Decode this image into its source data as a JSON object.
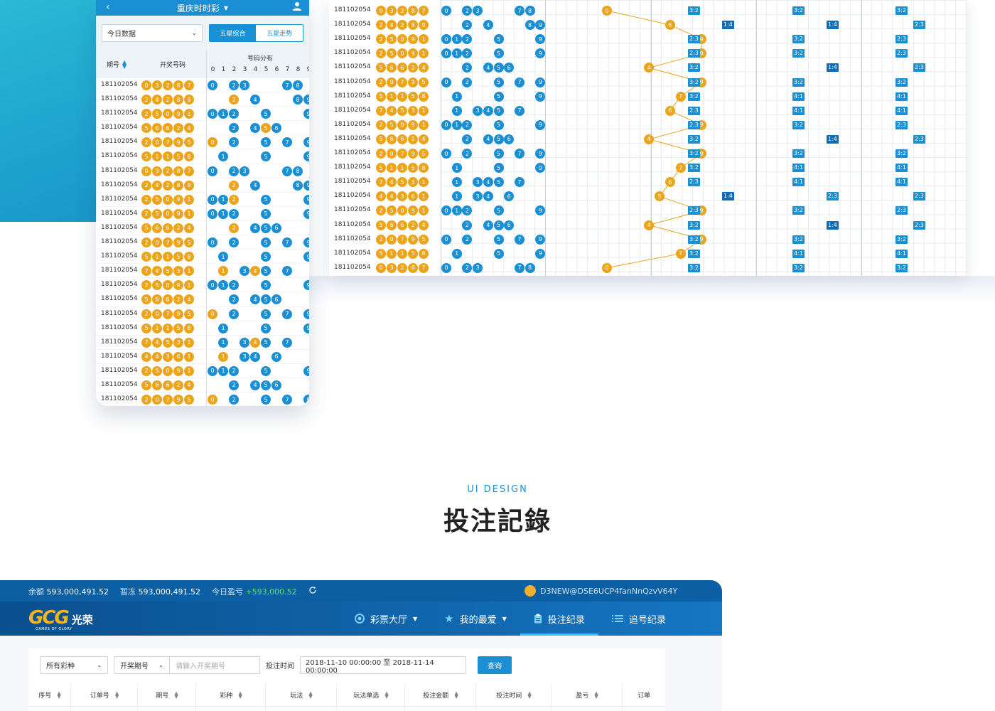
{
  "phone": {
    "title": "重庆时时彩",
    "filter_select": "今日数据",
    "seg": [
      "五星综合",
      "五星走势"
    ],
    "col_period": "期号",
    "col_numbers": "开奖号码",
    "col_distribution": "号码分布",
    "dist_digits": [
      "0",
      "1",
      "2",
      "3",
      "4",
      "5",
      "6",
      "7",
      "8",
      "9"
    ],
    "rows": [
      {
        "id": "181102054",
        "nums": [
          "0",
          "3",
          "2",
          "8",
          "7"
        ],
        "dist": [
          "0",
          "2",
          "3",
          "7",
          "8"
        ]
      },
      {
        "id": "181102054",
        "nums": [
          "2",
          "4",
          "2",
          "8",
          "9"
        ],
        "dist": [
          "2",
          "4",
          "8",
          "9"
        ]
      },
      {
        "id": "181102054",
        "nums": [
          "2",
          "5",
          "0",
          "9",
          "1"
        ],
        "dist": [
          "0",
          "1",
          "2",
          "5",
          "9"
        ]
      },
      {
        "id": "181102054",
        "nums": [
          "5",
          "6",
          "6",
          "2",
          "4"
        ],
        "dist": [
          "2",
          "4",
          "5",
          "6"
        ]
      },
      {
        "id": "181102054",
        "nums": [
          "2",
          "0",
          "7",
          "9",
          "5"
        ],
        "dist": [
          "0",
          "2",
          "5",
          "7",
          "9"
        ]
      },
      {
        "id": "181102054",
        "nums": [
          "5",
          "1",
          "1",
          "5",
          "8"
        ],
        "dist": [
          "1",
          "5",
          "9"
        ]
      },
      {
        "id": "181102054",
        "nums": [
          "0",
          "3",
          "2",
          "8",
          "7"
        ],
        "dist": [
          "0",
          "2",
          "3",
          "7",
          "8"
        ]
      },
      {
        "id": "181102054",
        "nums": [
          "2",
          "4",
          "2",
          "8",
          "9"
        ],
        "dist": [
          "2",
          "4",
          "8",
          "9"
        ]
      },
      {
        "id": "181102054",
        "nums": [
          "2",
          "5",
          "0",
          "9",
          "1"
        ],
        "dist": [
          "0",
          "1",
          "2",
          "5",
          "9"
        ]
      },
      {
        "id": "181102054",
        "nums": [
          "2",
          "5",
          "0",
          "9",
          "1"
        ],
        "dist": [
          "0",
          "1",
          "2",
          "5",
          "9"
        ]
      },
      {
        "id": "181102054",
        "nums": [
          "5",
          "6",
          "6",
          "2",
          "4"
        ],
        "dist": [
          "2",
          "4",
          "5",
          "6"
        ]
      },
      {
        "id": "181102054",
        "nums": [
          "2",
          "0",
          "7",
          "9",
          "5"
        ],
        "dist": [
          "0",
          "2",
          "5",
          "7",
          "9"
        ]
      },
      {
        "id": "181102054",
        "nums": [
          "5",
          "1",
          "1",
          "5",
          "8"
        ],
        "dist": [
          "1",
          "5",
          "9"
        ]
      },
      {
        "id": "181102054",
        "nums": [
          "7",
          "4",
          "5",
          "3",
          "1"
        ],
        "dist": [
          "1",
          "3",
          "4",
          "5",
          "7"
        ]
      },
      {
        "id": "181102054",
        "nums": [
          "2",
          "5",
          "0",
          "9",
          "1"
        ],
        "dist": [
          "0",
          "1",
          "2",
          "5",
          "9"
        ]
      },
      {
        "id": "181102054",
        "nums": [
          "5",
          "6",
          "6",
          "2",
          "4"
        ],
        "dist": [
          "2",
          "4",
          "5",
          "6"
        ]
      },
      {
        "id": "181102054",
        "nums": [
          "2",
          "0",
          "7",
          "9",
          "5"
        ],
        "dist": [
          "0",
          "2",
          "5",
          "7",
          "9"
        ]
      },
      {
        "id": "181102054",
        "nums": [
          "5",
          "1",
          "1",
          "5",
          "8"
        ],
        "dist": [
          "1",
          "5",
          "9"
        ]
      },
      {
        "id": "181102054",
        "nums": [
          "7",
          "4",
          "5",
          "3",
          "1"
        ],
        "dist": [
          "1",
          "3",
          "4",
          "5",
          "7"
        ]
      },
      {
        "id": "181102054",
        "nums": [
          "4",
          "4",
          "3",
          "6",
          "1"
        ],
        "dist": [
          "1",
          "3",
          "4",
          "6"
        ]
      },
      {
        "id": "181102054",
        "nums": [
          "2",
          "5",
          "0",
          "9",
          "1"
        ],
        "dist": [
          "0",
          "1",
          "2",
          "5",
          "9"
        ]
      },
      {
        "id": "181102054",
        "nums": [
          "5",
          "6",
          "6",
          "2",
          "4"
        ],
        "dist": [
          "2",
          "4",
          "5",
          "6"
        ]
      },
      {
        "id": "181102054",
        "nums": [
          "2",
          "0",
          "7",
          "9",
          "5"
        ],
        "dist": [
          "0",
          "2",
          "5",
          "7",
          "9"
        ]
      }
    ]
  },
  "trend": {
    "rows": [
      {
        "id": "181102054",
        "nums": [
          "0",
          "3",
          "2",
          "8",
          "7"
        ],
        "dist": [
          "0",
          "2",
          "3",
          "7",
          "8"
        ],
        "trend": "0",
        "tags": [
          [
            "3:2",
            0
          ],
          [
            "3:2",
            2
          ],
          [
            "3:2",
            4
          ]
        ]
      },
      {
        "id": "181102054",
        "nums": [
          "2",
          "4",
          "2",
          "8",
          "9"
        ],
        "dist": [
          "2",
          "4",
          "8",
          "9"
        ],
        "trend": "6",
        "tags": [
          [
            "1:4",
            1
          ],
          [
            "1:4",
            3
          ],
          [
            "2:3",
            5
          ]
        ]
      },
      {
        "id": "181102054",
        "nums": [
          "2",
          "5",
          "0",
          "9",
          "1"
        ],
        "dist": [
          "0",
          "1",
          "2",
          "5",
          "9"
        ],
        "trend": "9",
        "tags": [
          [
            "2:3",
            0
          ],
          [
            "3:2",
            2
          ],
          [
            "2:3",
            4
          ]
        ]
      },
      {
        "id": "181102054",
        "nums": [
          "2",
          "5",
          "0",
          "9",
          "1"
        ],
        "dist": [
          "0",
          "1",
          "2",
          "5",
          "9"
        ],
        "trend": "9",
        "tags": [
          [
            "2:3",
            0
          ],
          [
            "3:2",
            2
          ],
          [
            "2:3",
            4
          ]
        ]
      },
      {
        "id": "181102054",
        "nums": [
          "5",
          "6",
          "6",
          "2",
          "4"
        ],
        "dist": [
          "2",
          "4",
          "5",
          "6"
        ],
        "trend": "4",
        "tags": [
          [
            "3:2",
            0
          ],
          [
            "1:4",
            3
          ],
          [
            "2:3",
            5
          ]
        ]
      },
      {
        "id": "181102054",
        "nums": [
          "2",
          "0",
          "7",
          "9",
          "5"
        ],
        "dist": [
          "0",
          "2",
          "5",
          "7",
          "9"
        ],
        "trend": "9",
        "tags": [
          [
            "3:2",
            0
          ],
          [
            "3:2",
            2
          ],
          [
            "3:2",
            4
          ]
        ]
      },
      {
        "id": "181102054",
        "nums": [
          "5",
          "1",
          "1",
          "5",
          "8"
        ],
        "dist": [
          "1",
          "5",
          "9"
        ],
        "trend": "7",
        "tags": [
          [
            "3:2",
            0
          ],
          [
            "4:1",
            2
          ],
          [
            "4:1",
            4
          ]
        ]
      },
      {
        "id": "181102054",
        "nums": [
          "7",
          "4",
          "5",
          "3",
          "1"
        ],
        "dist": [
          "1",
          "3",
          "4",
          "5",
          "7"
        ],
        "trend": "6",
        "tags": [
          [
            "2:3",
            0
          ],
          [
            "4:1",
            2
          ],
          [
            "4:1",
            4
          ]
        ]
      },
      {
        "id": "181102054",
        "nums": [
          "2",
          "5",
          "0",
          "9",
          "1"
        ],
        "dist": [
          "0",
          "1",
          "2",
          "5",
          "9"
        ],
        "trend": "9",
        "tags": [
          [
            "2:3",
            0
          ],
          [
            "3:2",
            2
          ],
          [
            "2:3",
            4
          ]
        ]
      },
      {
        "id": "181102054",
        "nums": [
          "5",
          "6",
          "6",
          "2",
          "4"
        ],
        "dist": [
          "2",
          "4",
          "5",
          "6"
        ],
        "trend": "4",
        "tags": [
          [
            "3:2",
            0
          ],
          [
            "1:4",
            3
          ],
          [
            "2:3",
            5
          ]
        ]
      },
      {
        "id": "181102054",
        "nums": [
          "2",
          "0",
          "7",
          "9",
          "5"
        ],
        "dist": [
          "0",
          "2",
          "5",
          "7",
          "9"
        ],
        "trend": "9",
        "tags": [
          [
            "3:2",
            0
          ],
          [
            "3:2",
            2
          ],
          [
            "3:2",
            4
          ]
        ]
      },
      {
        "id": "181102054",
        "nums": [
          "5",
          "1",
          "1",
          "5",
          "8"
        ],
        "dist": [
          "1",
          "5",
          "9"
        ],
        "trend": "7",
        "tags": [
          [
            "3:2",
            0
          ],
          [
            "4:1",
            2
          ],
          [
            "4:1",
            4
          ]
        ]
      },
      {
        "id": "181102054",
        "nums": [
          "7",
          "4",
          "5",
          "3",
          "1"
        ],
        "dist": [
          "1",
          "3",
          "4",
          "5",
          "7"
        ],
        "trend": "6",
        "tags": [
          [
            "2:3",
            0
          ],
          [
            "4:1",
            2
          ],
          [
            "4:1",
            4
          ]
        ]
      },
      {
        "id": "181102054",
        "nums": [
          "4",
          "4",
          "3",
          "6",
          "1"
        ],
        "dist": [
          "1",
          "3",
          "4",
          "6"
        ],
        "trend": "5",
        "tags": [
          [
            "1:4",
            1
          ],
          [
            "2:3",
            3
          ],
          [
            "2:3",
            5
          ]
        ]
      },
      {
        "id": "181102054",
        "nums": [
          "2",
          "5",
          "0",
          "9",
          "1"
        ],
        "dist": [
          "0",
          "1",
          "2",
          "5",
          "9"
        ],
        "trend": "9",
        "tags": [
          [
            "2:3",
            0
          ],
          [
            "3:2",
            2
          ],
          [
            "2:3",
            4
          ]
        ]
      },
      {
        "id": "181102054",
        "nums": [
          "5",
          "6",
          "6",
          "2",
          "4"
        ],
        "dist": [
          "2",
          "4",
          "5",
          "6"
        ],
        "trend": "4",
        "tags": [
          [
            "3:2",
            0
          ],
          [
            "1:4",
            3
          ],
          [
            "2:3",
            5
          ]
        ]
      },
      {
        "id": "181102054",
        "nums": [
          "2",
          "0",
          "7",
          "9",
          "5"
        ],
        "dist": [
          "0",
          "2",
          "5",
          "7",
          "9"
        ],
        "trend": "9",
        "tags": [
          [
            "3:2",
            0
          ],
          [
            "3:2",
            2
          ],
          [
            "3:2",
            4
          ]
        ]
      },
      {
        "id": "181102054",
        "nums": [
          "5",
          "1",
          "1",
          "5",
          "8"
        ],
        "dist": [
          "1",
          "5",
          "9"
        ],
        "trend": "7",
        "tags": [
          [
            "3:2",
            0
          ],
          [
            "4:1",
            2
          ],
          [
            "4:1",
            4
          ]
        ]
      },
      {
        "id": "181102054",
        "nums": [
          "0",
          "3",
          "2",
          "8",
          "7"
        ],
        "dist": [
          "0",
          "2",
          "3",
          "7",
          "8"
        ],
        "trend": "0",
        "tags": [
          [
            "3:2",
            0
          ],
          [
            "3:2",
            2
          ],
          [
            "3:2",
            4
          ]
        ]
      }
    ]
  },
  "section": {
    "subtitle": "UI DESIGN",
    "title": "投注記錄"
  },
  "desk": {
    "balance_label": "余额",
    "balance": "593,000,491.52",
    "frozen_label": "暂冻",
    "frozen": "593,000,491.52",
    "profit_label": "今日盈亏",
    "profit": "+593,000.52",
    "account": "D3NEW@DSE6UCP4fanNnQzvV64Y",
    "logo_text": "GCG",
    "logo_cn": "光荣",
    "logo_sub": "GAMES OF GLORY",
    "nav": [
      "彩票大厅",
      "我的最爱",
      "投注纪录",
      "追号纪录"
    ],
    "filter_lottery": "所有彩种",
    "filter_period": "开奖期号",
    "period_placeholder": "请输入开奖期号",
    "time_label": "投注时间",
    "time_range": "2018-11-10 00:00:00 至 2018-11-14 00:00:00",
    "query": "查询",
    "columns": [
      "序号",
      "订单号",
      "期号",
      "彩种",
      "玩法",
      "玩法单选",
      "投注金额",
      "投注时间",
      "盈亏",
      "订单"
    ]
  },
  "colors": {
    "primary": "#1a8fd4",
    "orange": "#eba41c",
    "navy": "#0d5fa3",
    "positive": "#5be07e"
  }
}
